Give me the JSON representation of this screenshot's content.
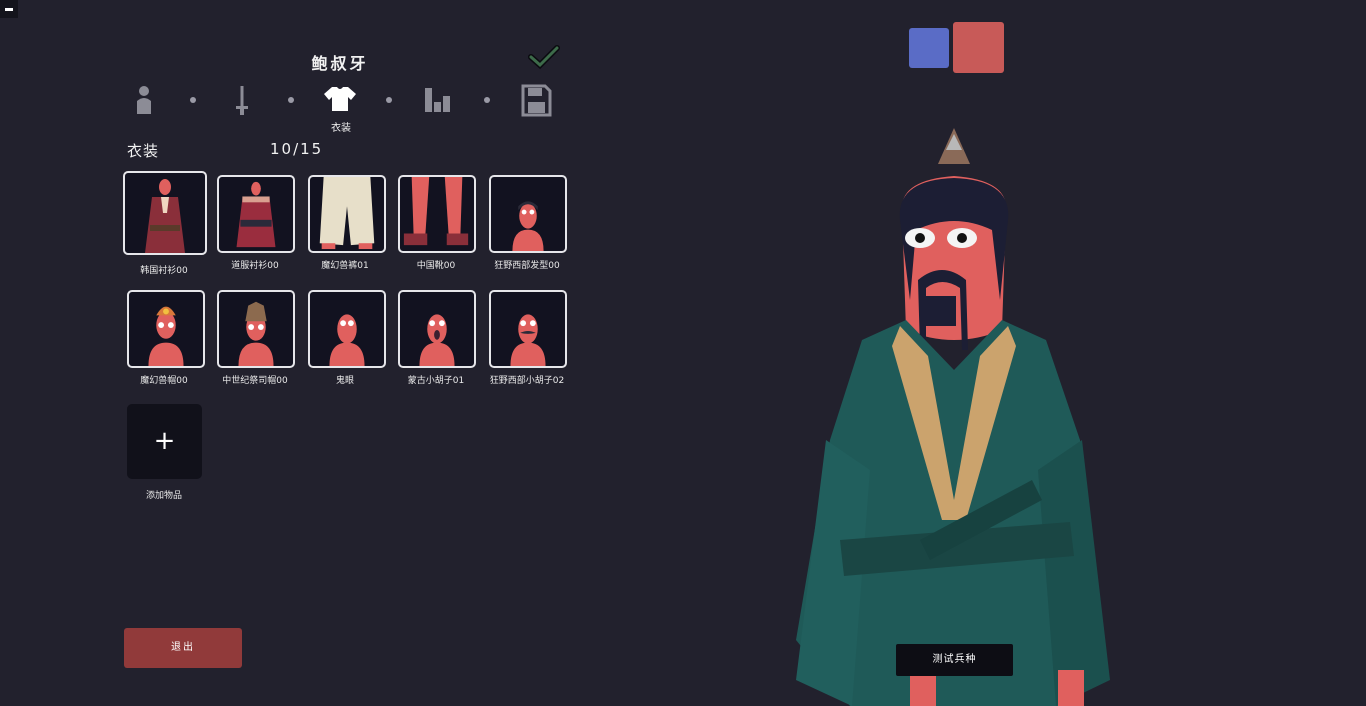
{
  "unit": {
    "name": "鲍叔牙"
  },
  "steps": [
    {
      "icon": "unit-base-icon"
    },
    {
      "icon": "weapon-icon"
    },
    {
      "icon": "clothing-icon",
      "label": "衣装",
      "active": true
    },
    {
      "icon": "stats-icon"
    },
    {
      "icon": "save-icon"
    }
  ],
  "clothing": {
    "title": "衣装",
    "count": "10/15",
    "items": [
      {
        "label": "韩国衬衫00"
      },
      {
        "label": "道服衬衫00"
      },
      {
        "label": "魔幻兽裤01"
      },
      {
        "label": "中国靴00"
      },
      {
        "label": "狂野西部发型00"
      },
      {
        "label": "魔幻兽帽00"
      },
      {
        "label": "中世纪祭司帽00"
      },
      {
        "label": "鬼眼"
      },
      {
        "label": "蒙古小胡子01"
      },
      {
        "label": "狂野西部小胡子02"
      }
    ],
    "add_label": "添加物品",
    "add_symbol": "+"
  },
  "exit_label": "退出",
  "test_label": "测试兵种",
  "colors": {
    "team_blue": "#5a6cc6",
    "team_red": "#c85a58",
    "exit": "#913a3a"
  }
}
